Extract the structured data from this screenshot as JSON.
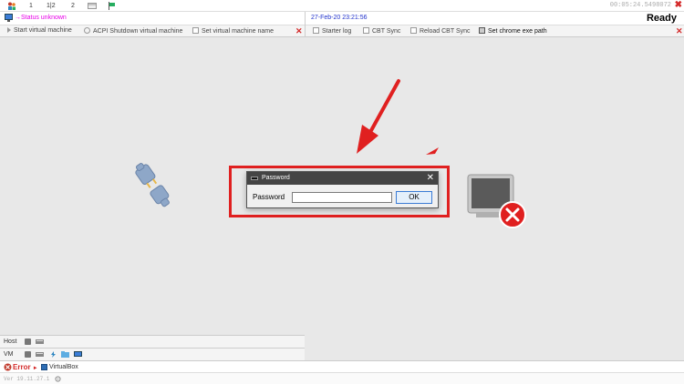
{
  "topbar": {
    "items": [
      "1",
      "1|2",
      "2"
    ],
    "timer": "00:05:24.5498072"
  },
  "status": {
    "left": "→Status unknown",
    "datetime": "27-Feb-20 23:21:56",
    "ready": "Ready"
  },
  "toolbar_left": [
    "Start virtual machine",
    "ACPI Shutdown virtual machine",
    "Set virtual machine name"
  ],
  "toolbar_right": [
    "Starter log",
    "CBT Sync",
    "Reload CBT Sync",
    "Set chrome exe path"
  ],
  "dialog": {
    "title": "Password",
    "label": "Password",
    "input_value": "",
    "ok_label": "OK",
    "close_glyph": "✕"
  },
  "bottom": {
    "host_label": "Host",
    "vm_label": "VM",
    "error_label": "Error",
    "error_arrow": "►",
    "virtualbox_label": "VirtualBox",
    "version": "Ver 19.11.27.1"
  },
  "colors": {
    "accent_red": "#e02020",
    "status_magenta": "#e800e8",
    "date_blue": "#2233cc"
  }
}
